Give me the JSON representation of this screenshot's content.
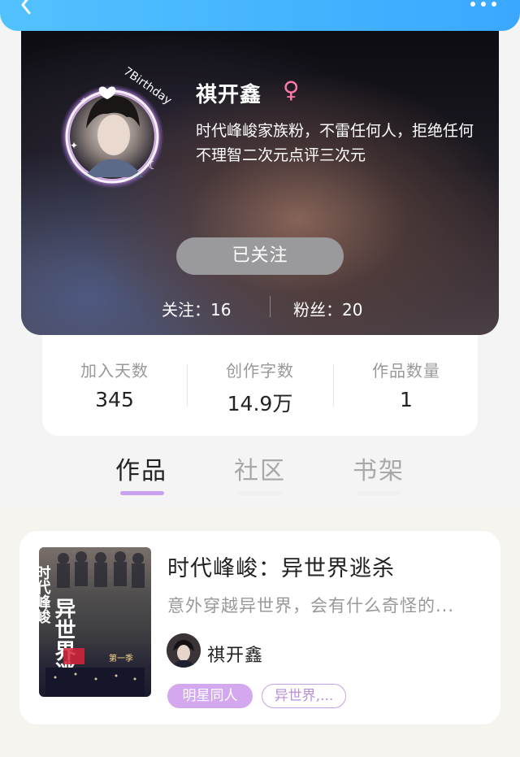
{
  "colors": {
    "topbar": "#3aa8ff",
    "follow_button": "#9a999c",
    "gender_female": "#ff7aa8",
    "tab_indicator_active": "#c9a3ef",
    "tag_purple": "#d3a8ee"
  },
  "topbar": {
    "back_icon": "chevron-left-icon",
    "more_icon": "more-dots-icon"
  },
  "profile": {
    "avatar_text": "7Birthday",
    "name": "祺开鑫",
    "gender_symbol": "♀",
    "bio": "时代峰峻家族粉，不雷任何人，拒绝任何不理智二次元点评三次元",
    "follow_button_label": "已关注",
    "following_label": "关注：",
    "following_count": "16",
    "fans_label": "粉丝：",
    "fans_count": "20"
  },
  "stats": [
    {
      "label": "加入天数",
      "value": "345"
    },
    {
      "label": "创作字数",
      "value": "14.9万"
    },
    {
      "label": "作品数量",
      "value": "1"
    }
  ],
  "tabs": [
    {
      "label": "作品",
      "active": true
    },
    {
      "label": "社区",
      "active": false
    },
    {
      "label": "书架",
      "active": false
    }
  ],
  "work": {
    "title": "时代峰峻：异世界逃杀",
    "description": "意外穿越异世界，会有什么奇怪的...",
    "author": "祺开鑫",
    "tags": [
      "明星同人",
      "异世界,..."
    ],
    "cover_text": {
      "vertical_left": "时代峰峻",
      "big": "异世界逃杀",
      "sub": "第一季"
    }
  }
}
